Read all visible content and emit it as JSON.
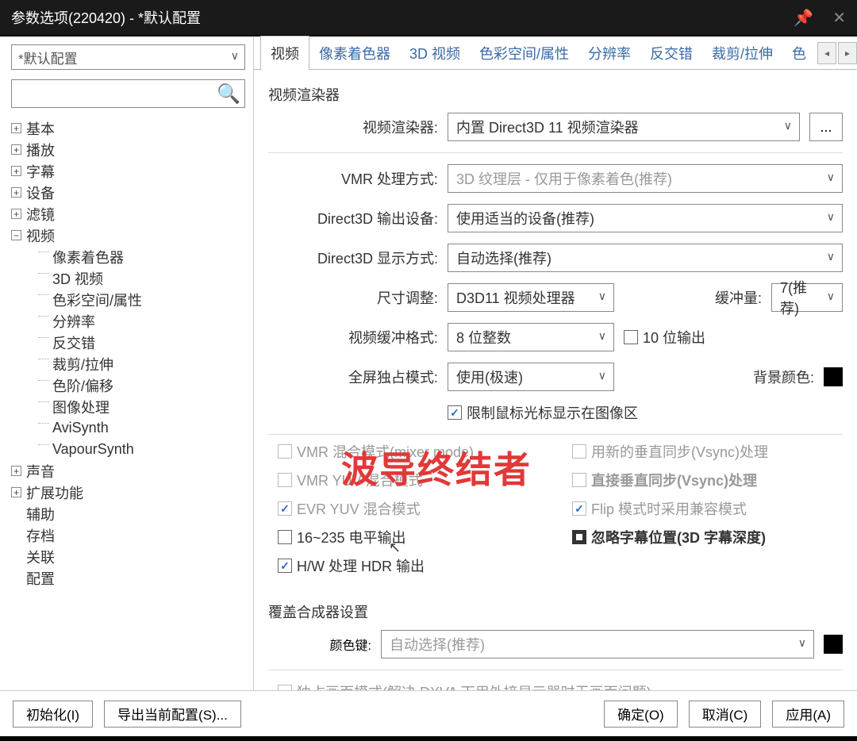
{
  "window": {
    "title": "参数选项(220420) - *默认配置"
  },
  "preset": {
    "value": "*默认配置"
  },
  "tree": {
    "basic": "基本",
    "playback": "播放",
    "subtitles": "字幕",
    "device": "设备",
    "filter": "滤镜",
    "video": "视频",
    "video_children": {
      "pixel_shader": "像素着色器",
      "video_3d": "3D 视频",
      "colorspace": "色彩空间/属性",
      "resolution": "分辨率",
      "deinterlace": "反交错",
      "crop_stretch": "裁剪/拉伸",
      "level_offset": "色阶/偏移",
      "image_proc": "图像处理",
      "avisynth": "AviSynth",
      "vapoursynth": "VapourSynth"
    },
    "audio": "声音",
    "extend": "扩展功能",
    "assist": "辅助",
    "archive": "存档",
    "associate": "关联",
    "config": "配置"
  },
  "tabs": {
    "video": "视频",
    "pixel_shader": "像素着色器",
    "video_3d": "3D 视频",
    "colorspace": "色彩空间/属性",
    "resolution": "分辨率",
    "deinterlace": "反交错",
    "crop_stretch": "裁剪/拉伸",
    "color_partial": "色"
  },
  "form": {
    "section_renderer": "视频渲染器",
    "renderer_label": "视频渲染器:",
    "renderer_value": "内置 Direct3D 11 视频渲染器",
    "renderer_more": "...",
    "vmr_label": "VMR 处理方式:",
    "vmr_value": "3D 纹理层 - 仅用于像素着色(推荐)",
    "d3d_device_label": "Direct3D 输出设备:",
    "d3d_device_value": "使用适当的设备(推荐)",
    "d3d_display_label": "Direct3D 显示方式:",
    "d3d_display_value": "自动选择(推荐)",
    "resize_label": "尺寸调整:",
    "resize_value": "D3D11 视频处理器",
    "buffer_label": "缓冲量:",
    "buffer_value": "7(推荐)",
    "buf_format_label": "视频缓冲格式:",
    "buf_format_value": "8 位整数",
    "chk_10bit": "10 位输出",
    "fullscreen_label": "全屏独占模式:",
    "fullscreen_value": "使用(极速)",
    "bgcolor_label": "背景颜色:",
    "chk_cursor": "限制鼠标光标显示在图像区",
    "chk_vmr_mixer": "VMR 混合模式(mixer mode)",
    "chk_vsync_new": "用新的垂直同步(Vsync)处理",
    "chk_vmr_yuv": "VMR YUV 混合模式",
    "chk_vsync_direct": "直接垂直同步(Vsync)处理",
    "chk_evr_yuv": "EVR YUV 混合模式",
    "chk_flip": "Flip 模式时采用兼容模式",
    "chk_16_235": "16~235 电平输出",
    "chk_ignore_sub": "忽略字幕位置(3D 字幕深度)",
    "chk_hw_hdr": "H/W 处理 HDR 输出",
    "section_overlay": "覆盖合成器设置",
    "colorkey_label": "颜色键:",
    "colorkey_value": "自动选择(推荐)",
    "chk_exclusive": "独占画面模式(解决 DXVA 下用外接显示器时无画面问题)"
  },
  "buttons": {
    "init": "初始化(I)",
    "export": "导出当前配置(S)...",
    "ok": "确定(O)",
    "cancel": "取消(C)",
    "apply": "应用(A)"
  },
  "watermark": "波导终结者"
}
